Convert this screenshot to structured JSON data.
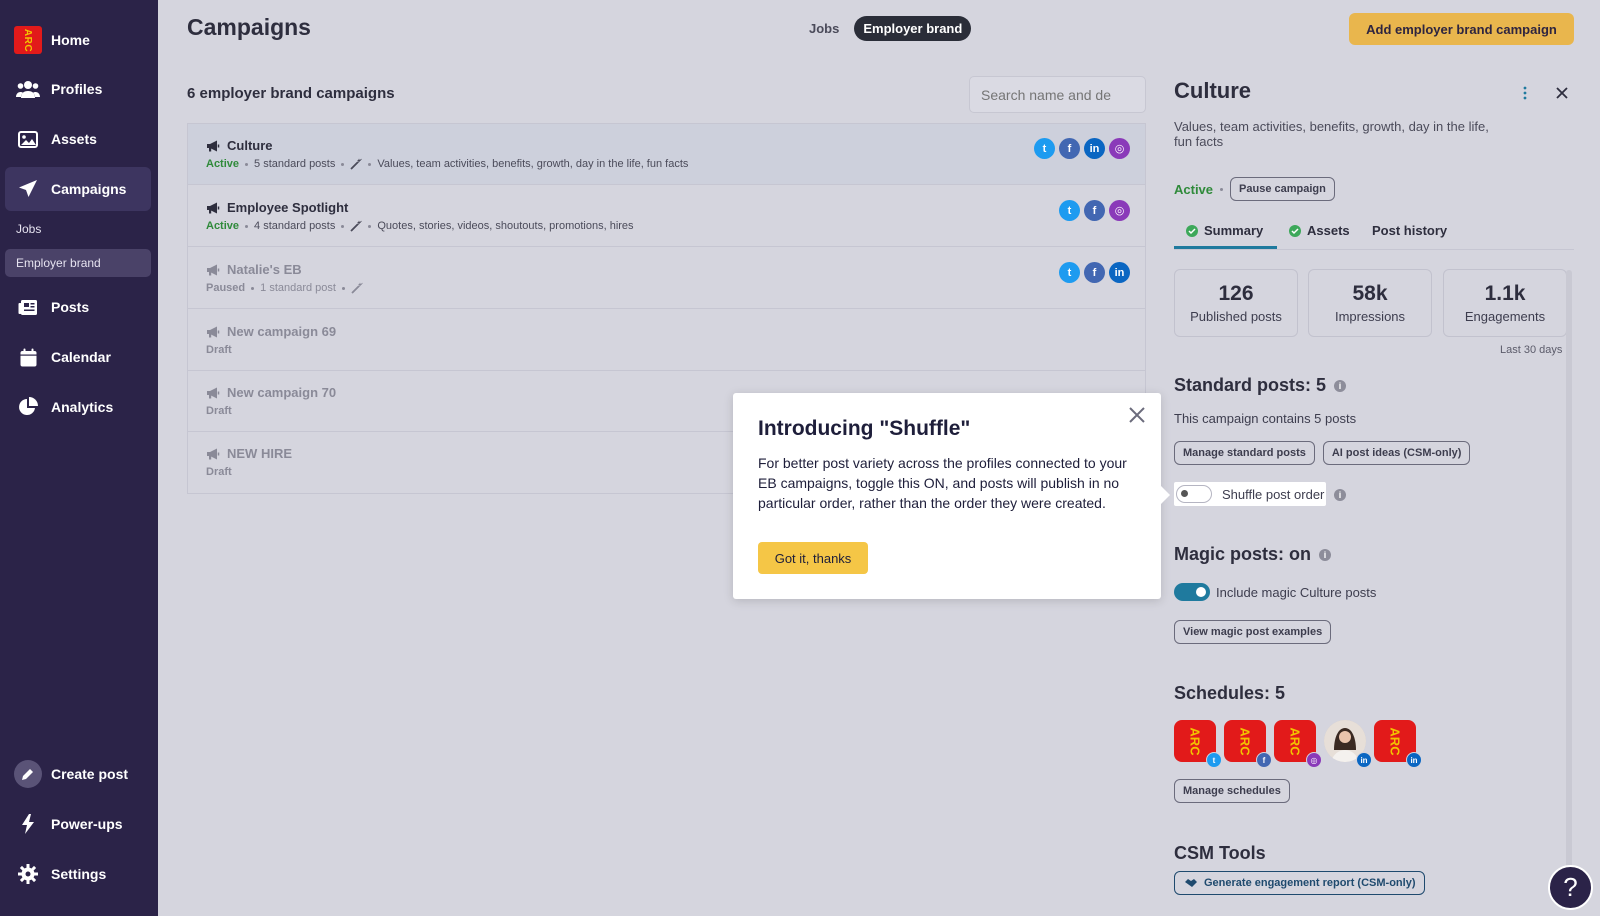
{
  "sidebar": {
    "logo": "ARC",
    "items": [
      {
        "label": "Home",
        "icon": "logo-icon"
      },
      {
        "label": "Profiles",
        "icon": "users-icon"
      },
      {
        "label": "Assets",
        "icon": "image-icon"
      },
      {
        "label": "Campaigns",
        "icon": "paper-plane-icon"
      },
      {
        "label": "Posts",
        "icon": "newspaper-icon"
      },
      {
        "label": "Calendar",
        "icon": "calendar-icon"
      },
      {
        "label": "Analytics",
        "icon": "pie-chart-icon"
      }
    ],
    "sub_items": [
      {
        "label": "Jobs"
      },
      {
        "label": "Employer brand"
      }
    ],
    "bottom_items": [
      {
        "label": "Create post",
        "icon": "pencil-icon"
      },
      {
        "label": "Power-ups",
        "icon": "lightning-icon"
      },
      {
        "label": "Settings",
        "icon": "gear-icon"
      }
    ]
  },
  "header": {
    "title": "Campaigns",
    "tabs": [
      {
        "label": "Jobs"
      },
      {
        "label": "Employer brand"
      }
    ],
    "add_button": "Add employer brand campaign"
  },
  "list": {
    "count_title": "6 employer brand campaigns",
    "search_placeholder": "Search name and de",
    "rows": [
      {
        "name": "Culture",
        "status": "Active",
        "posts": "5 standard posts",
        "description": "Values, team activities, benefits, growth, day in the life, fun facts",
        "socials": [
          "tw",
          "fb",
          "li",
          "ig"
        ]
      },
      {
        "name": "Employee Spotlight",
        "status": "Active",
        "posts": "4 standard posts",
        "description": "Quotes, stories, videos, shoutouts, promotions, hires",
        "socials": [
          "tw",
          "fb",
          "ig"
        ]
      },
      {
        "name": "Natalie's EB",
        "status": "Paused",
        "posts": "1 standard post",
        "description": "",
        "socials": [
          "tw",
          "fb",
          "li"
        ]
      },
      {
        "name": "New campaign 69",
        "status": "Draft",
        "posts": "",
        "description": "",
        "socials": []
      },
      {
        "name": "New campaign 70",
        "status": "Draft",
        "posts": "",
        "description": "",
        "socials": []
      },
      {
        "name": "NEW HIRE",
        "status": "Draft",
        "posts": "",
        "description": "",
        "socials": []
      }
    ]
  },
  "popup": {
    "title": "Introducing \"Shuffle\"",
    "body": "For better post variety across the profiles connected to your EB campaigns, toggle this ON, and posts will publish in no particular order, rather than the order they were created.",
    "button": "Got it, thanks"
  },
  "panel": {
    "title": "Culture",
    "description": "Values, team activities, benefits, growth, day in the life, fun facts",
    "status": "Active",
    "pause_button": "Pause campaign",
    "tabs": [
      {
        "label": "Summary"
      },
      {
        "label": "Assets"
      },
      {
        "label": "Post history"
      }
    ],
    "stats": [
      {
        "value": "126",
        "label": "Published posts"
      },
      {
        "value": "58k",
        "label": "Impressions"
      },
      {
        "value": "1.1k",
        "label": "Engagements"
      }
    ],
    "stats_footnote": "Last 30 days",
    "standard_title": "Standard posts: 5",
    "standard_text": "This campaign contains 5 posts",
    "manage_standard": "Manage standard posts",
    "ai_ideas": "AI post ideas (CSM-only)",
    "shuffle_label": "Shuffle post order",
    "magic_title": "Magic posts: on",
    "magic_label": "Include magic Culture posts",
    "magic_examples": "View magic post examples",
    "schedules_title": "Schedules: 5",
    "schedules": [
      {
        "avatar": "ARC",
        "network": "tw"
      },
      {
        "avatar": "ARC",
        "network": "fb"
      },
      {
        "avatar": "ARC",
        "network": "ig"
      },
      {
        "avatar": "",
        "network": "li"
      },
      {
        "avatar": "ARC",
        "network": "li"
      }
    ],
    "manage_schedules": "Manage schedules",
    "csm_title": "CSM Tools",
    "csm_button": "Generate engagement report (CSM-only)"
  },
  "help": "?",
  "colors": {
    "sidebar": "#2b2348",
    "accent": "#e9b64d",
    "popup_button": "#f5c646",
    "active_status": "#2f8a3a",
    "toggle_on": "#1f7a9e"
  }
}
